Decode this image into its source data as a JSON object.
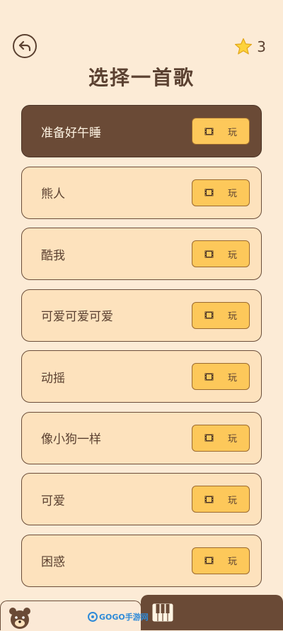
{
  "header": {
    "back_icon": "back-arrow-icon",
    "star_icon": "star-icon",
    "star_count": "3",
    "title": "选择一首歌"
  },
  "songs": [
    {
      "name": "准备好午睡",
      "play_label": "玩",
      "selected": true
    },
    {
      "name": "熊人",
      "play_label": "玩"
    },
    {
      "name": "酷我",
      "play_label": "玩"
    },
    {
      "name": "可爱可爱可爱",
      "play_label": "玩"
    },
    {
      "name": "动摇",
      "play_label": "玩"
    },
    {
      "name": "像小狗一样",
      "play_label": "玩"
    },
    {
      "name": "可爱",
      "play_label": "玩"
    },
    {
      "name": "困惑",
      "play_label": "玩"
    }
  ],
  "bottom_bar": {
    "left_icon": "bear-icon",
    "right_icon": "piano-icon"
  },
  "watermark": "GOGO手游网",
  "colors": {
    "background": "#fcebd6",
    "card": "#fde2bd",
    "selected_card": "#6a4a36",
    "play_button": "#fdc85a",
    "text": "#5b4131"
  }
}
